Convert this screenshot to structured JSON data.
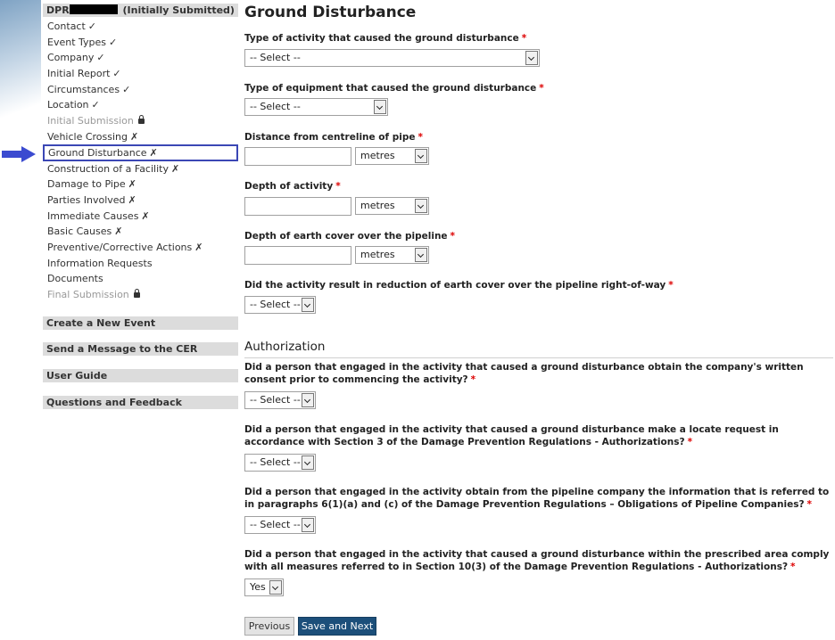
{
  "sidebar": {
    "header_prefix": "DPR",
    "header_suffix": " (Initially Submitted)",
    "items": [
      {
        "label": "Contact",
        "mark": "✓"
      },
      {
        "label": "Event Types",
        "mark": "✓"
      },
      {
        "label": "Company",
        "mark": "✓"
      },
      {
        "label": "Initial Report",
        "mark": "✓"
      },
      {
        "label": "Circumstances",
        "mark": "✓"
      },
      {
        "label": "Location",
        "mark": "✓"
      },
      {
        "label": "Initial Submission",
        "mark": "lock-icon"
      },
      {
        "label": "Vehicle Crossing",
        "mark": "✗"
      },
      {
        "label": "Ground Disturbance",
        "mark": "✗"
      },
      {
        "label": "Construction of a Facility",
        "mark": "✗"
      },
      {
        "label": "Damage to Pipe",
        "mark": "✗"
      },
      {
        "label": "Parties Involved",
        "mark": "✗"
      },
      {
        "label": "Immediate Causes",
        "mark": "✗"
      },
      {
        "label": "Basic Causes",
        "mark": "✗"
      },
      {
        "label": "Preventive/Corrective Actions",
        "mark": "✗"
      },
      {
        "label": "Information Requests",
        "mark": ""
      },
      {
        "label": "Documents",
        "mark": ""
      },
      {
        "label": "Final Submission",
        "mark": "lock-icon"
      }
    ],
    "links": [
      {
        "label": "Create a New Event"
      },
      {
        "label": "Send a Message to the CER"
      },
      {
        "label": "User Guide"
      },
      {
        "label": "Questions and Feedback"
      }
    ]
  },
  "main": {
    "title": "Ground Disturbance",
    "q_activity_type": "Type of activity that caused the ground disturbance",
    "q_equipment_type": "Type of equipment that caused the ground disturbance",
    "q_distance": "Distance from centreline of pipe",
    "q_depth_activity": "Depth of activity",
    "q_depth_cover": "Depth of earth cover over the pipeline",
    "q_reduction": "Did the activity result in reduction of earth cover over the pipeline right-of-way",
    "select_placeholder": "-- Select --",
    "unit_metres": "metres",
    "auth_title": "Authorization",
    "q_consent": "Did a person that engaged in the activity that caused a ground disturbance obtain the company's written consent prior to commencing the activity?",
    "q_locate": "Did a person that engaged in the activity that caused a ground disturbance make a locate request in accordance with Section 3 of the Damage Prevention Regulations - Authorizations?",
    "q_info": "Did a person that engaged in the activity obtain from the pipeline company the information that is referred to in paragraphs 6(1)(a) and (c) of the Damage Prevention Regulations – Obligations of Pipeline Companies?",
    "q_comply": "Did a person that engaged in the activity that caused a ground disturbance within the prescribed area comply with all measures referred to in Section 10(3) of the Damage Prevention Regulations - Authorizations?",
    "comply_value": "Yes",
    "required_mark": "*",
    "btn_previous": "Previous",
    "btn_save_next": "Save and Next"
  },
  "colors": {
    "active_border": "#3b47b5",
    "arrow": "#3b4bd0",
    "primary_button": "#1c4f7a",
    "required": "#dd0000"
  }
}
